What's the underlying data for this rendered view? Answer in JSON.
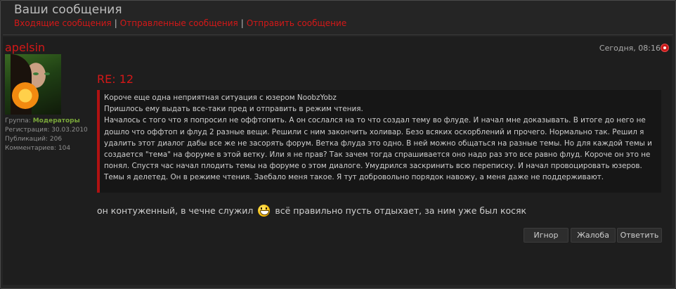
{
  "header": {
    "title": "Ваши сообщения",
    "tabs": [
      "Входящие сообщения",
      "Отправленные сообщения",
      "Отправить сообщение"
    ],
    "separator": "|"
  },
  "post": {
    "author": "apelsin",
    "date": "Сегодня, 08:16",
    "user": {
      "group_label": "Группа:",
      "group_value": "Модераторы",
      "registration": "Регистрация: 30.03.2010",
      "posts": "Публикаций: 206",
      "comments": "Комментариев: 104"
    },
    "subject": "RE: 12",
    "quote_lines": [
      "Короче еще одна неприятная ситуация с юзером NoobzYobz",
      "Пришлось ему выдать все-таки пред и отправить в режим чтения.",
      "Началось с того что я попросил не оффтопить. А он сослался на то что создал тему во флуде. И начал мне доказывать. В итоге до него не дошло что оффтоп и флуд 2 разные вещи. Решили с ним закончить холивар. Безо всяких оскорблений и прочего. Нормально так. Решил я удалить этот диалог дабы все же не засорять форум. Ветка флуда это одно. В ней можно общаться на разные темы. Но для каждой темы и создается \"тема\" на форуме в этой ветку. Или я не прав? Так зачем тогда спрашивается оно надо раз это все равно флуд. Короче он это не понял. Спустя час начал плодить темы на форуме о этом диалоге. Умудрился заскринить всю переписку. И начал провоцировать юзеров. Темы я делетед. Он в режиме чтения. Заебало меня такое. Я тут добровольно порядок навожу, а меня даже не поддерживают."
    ],
    "message_before": "он контуженный, в чечне служил",
    "message_after": "всё правильно пусть отдыхает, за ним уже был косяк",
    "buttons": {
      "ignore": "Игнор",
      "complaint": "Жалоба",
      "reply": "Ответить"
    }
  },
  "colors": {
    "accent": "#d41818",
    "group": "#7aa83a",
    "background": "#252525"
  },
  "icons": [
    "date-icon",
    "smiley-icon",
    "avatar-image"
  ]
}
